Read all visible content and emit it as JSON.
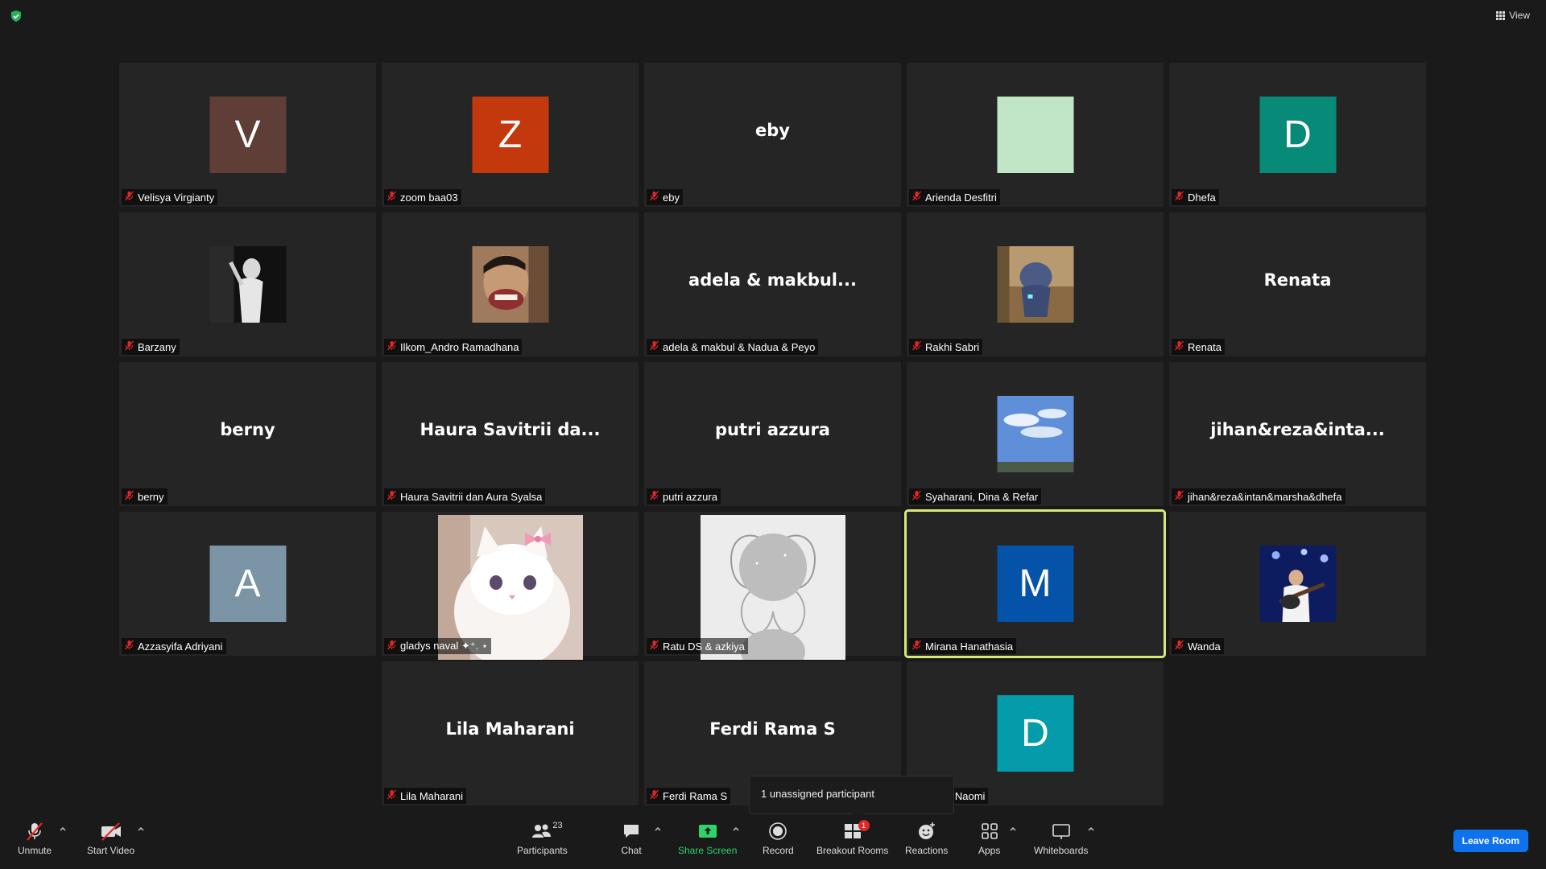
{
  "window": {
    "view_label": "View"
  },
  "tiles": [
    {
      "type": "initial",
      "initial": "V",
      "color": "#5e3e36",
      "name": "Velisya Virgianty"
    },
    {
      "type": "initial",
      "initial": "Z",
      "color": "#c4380e",
      "name": "zoom baa03"
    },
    {
      "type": "text",
      "bigname": "eby",
      "name": "eby"
    },
    {
      "type": "initial",
      "initial": "",
      "color": "#c1e6c7",
      "name": "Arienda Desfitri"
    },
    {
      "type": "initial",
      "initial": "D",
      "color": "#078a78",
      "name": "Dhefa"
    },
    {
      "type": "photo",
      "photo": "bw-singer",
      "name": "Barzany"
    },
    {
      "type": "photo",
      "photo": "face-filter",
      "name": "Ilkom_Andro Ramadhana"
    },
    {
      "type": "text",
      "bigname": "adela & makbul...",
      "name": "adela & makbul & Nadua & Peyo"
    },
    {
      "type": "photo",
      "photo": "toy-figure",
      "name": "Rakhi Sabri"
    },
    {
      "type": "text",
      "bigname": "Renata",
      "name": "Renata"
    },
    {
      "type": "text",
      "bigname": "berny",
      "name": "berny"
    },
    {
      "type": "text",
      "bigname": "Haura Savitrii da...",
      "name": "Haura Savitrii dan Aura Syalsa"
    },
    {
      "type": "text",
      "bigname": "putri azzura",
      "name": "putri azzura"
    },
    {
      "type": "photo",
      "photo": "sky",
      "name": "Syaharani, Dina & Refar"
    },
    {
      "type": "text",
      "bigname": "jihan&reza&inta...",
      "name": "jihan&reza&intan&marsha&dhefa"
    },
    {
      "type": "initial",
      "initial": "A",
      "color": "#7b95a6",
      "name": "Azzasyifa Adriyani"
    },
    {
      "type": "photo",
      "photo": "white-cat",
      "name": "gladys naval ✦⁺. ⋆"
    },
    {
      "type": "photo",
      "photo": "butterfly-art",
      "name": "Ratu DS & azkiya"
    },
    {
      "type": "initial",
      "initial": "M",
      "color": "#0553a8",
      "name": "Mirana Hanathasia",
      "speaking": true
    },
    {
      "type": "photo",
      "photo": "guitarist",
      "name": "Wanda"
    },
    {
      "type": "text",
      "bigname": "Lila Maharani",
      "name": "Lila Maharani"
    },
    {
      "type": "text",
      "bigname": "Ferdi Rama S",
      "name": "Ferdi Rama S"
    },
    {
      "type": "initial",
      "initial": "D",
      "color": "#049caa",
      "name": "Sekar,Naomi"
    }
  ],
  "tooltip": {
    "text": "1 unassigned participant"
  },
  "toolbar": {
    "unmute": "Unmute",
    "start_video": "Start Video",
    "participants": "Participants",
    "participants_count": "23",
    "chat": "Chat",
    "share_screen": "Share Screen",
    "record": "Record",
    "breakout_rooms": "Breakout Rooms",
    "breakout_badge": "1",
    "reactions": "Reactions",
    "apps": "Apps",
    "whiteboards": "Whiteboards",
    "leave_room": "Leave Room"
  },
  "colors": {
    "accent_green": "#2fd36b",
    "speaking_border": "#d5ea7a",
    "leave_blue": "#0e72ed"
  }
}
